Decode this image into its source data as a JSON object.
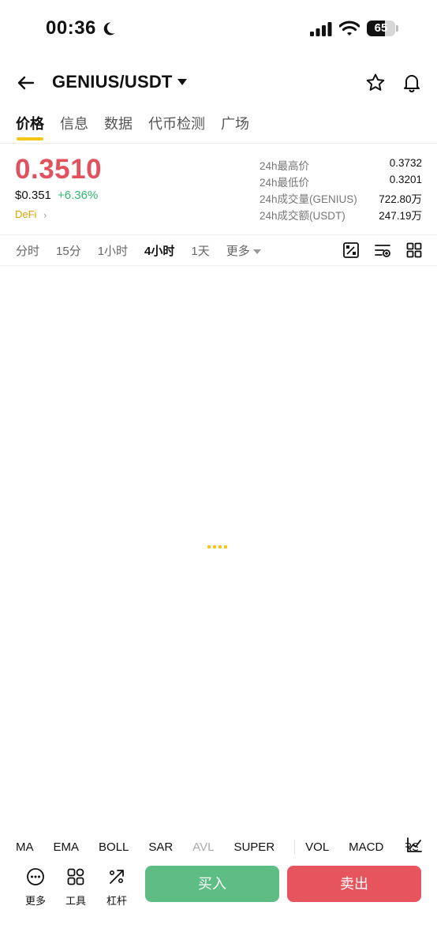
{
  "status_bar": {
    "time": "00:36",
    "battery": "65",
    "battery_level": 0.65
  },
  "header": {
    "pair": "GENIUS/USDT"
  },
  "tabs": [
    {
      "label": "价格",
      "active": true
    },
    {
      "label": "信息",
      "active": false
    },
    {
      "label": "数据",
      "active": false
    },
    {
      "label": "代币检测",
      "active": false
    },
    {
      "label": "广场",
      "active": false
    }
  ],
  "price": {
    "last": "0.3510",
    "usd": "$0.351",
    "change": "+6.36%",
    "tag": "DeFi"
  },
  "stats": [
    {
      "label": "24h最高价",
      "value": "0.3732"
    },
    {
      "label": "24h最低价",
      "value": "0.3201"
    },
    {
      "label": "24h成交量(GENIUS)",
      "value": "722.80万"
    },
    {
      "label": "24h成交额(USDT)",
      "value": "247.19万"
    }
  ],
  "timeframes": [
    {
      "label": "分时",
      "active": false
    },
    {
      "label": "15分",
      "active": false
    },
    {
      "label": "1小时",
      "active": false
    },
    {
      "label": "4小时",
      "active": true
    },
    {
      "label": "1天",
      "active": false
    },
    {
      "label": "更多",
      "active": false
    }
  ],
  "toolbar_icons": [
    "draw-tool-icon",
    "indicator-settings-icon",
    "layout-grid-icon"
  ],
  "indicators": {
    "main": [
      "MA",
      "EMA",
      "BOLL",
      "SAR",
      "AVL",
      "SUPER"
    ],
    "sub": [
      "VOL",
      "MACD",
      "RSI"
    ]
  },
  "actions": {
    "more": "更多",
    "tools": "工具",
    "leverage": "杠杆",
    "buy": "买入",
    "sell": "卖出"
  },
  "colors": {
    "up": "#2fb870",
    "down": "#e0525e",
    "accent": "#f5c518",
    "buy": "#5ebd84",
    "sell": "#e6545e"
  }
}
